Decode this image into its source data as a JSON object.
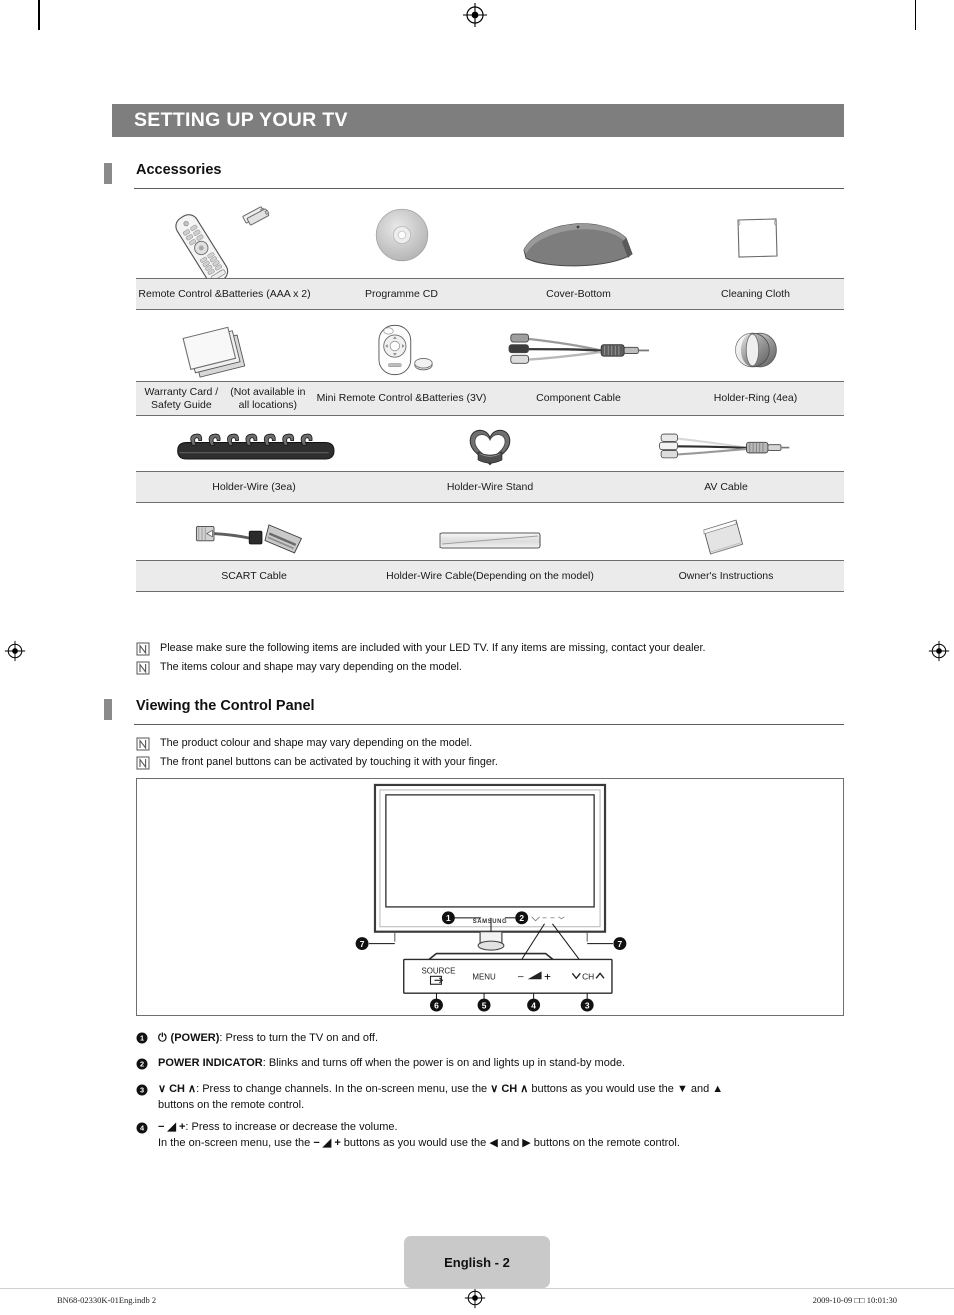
{
  "document": {
    "chapter_title": "SETTING UP YOUR TV",
    "page_label": "English - 2",
    "print_left": "BN68-02330K-01Eng.indb   2",
    "print_right": "2009-10-09   □□ 10:01:30"
  },
  "colors": {
    "banner_bg": "#7e7e7e",
    "banner_text": "#ffffff",
    "table_row_bg": "#ebebeb",
    "rule": "#6e6e6e",
    "footer_badge_bg": "#c9c9c9"
  },
  "sections": {
    "accessories": {
      "heading": "Accessories"
    },
    "control_panel": {
      "heading": "Viewing the Control Panel"
    }
  },
  "accessories": {
    "rows": [
      {
        "columns": 4,
        "items": [
          {
            "icon": "remote-control-with-batteries",
            "label": "Remote Control &\nBatteries (AAA x 2)"
          },
          {
            "icon": "programme-cd-disc",
            "label": "Programme CD"
          },
          {
            "icon": "cover-bottom-panel",
            "label": "Cover-Bottom"
          },
          {
            "icon": "cleaning-cloth",
            "label": "Cleaning Cloth"
          }
        ]
      },
      {
        "columns": 4,
        "items": [
          {
            "icon": "warranty-card-safety-guide",
            "label": "Warranty Card / Safety Guide\n(Not available in all locations)"
          },
          {
            "icon": "mini-remote-control-with-coin-battery",
            "label": "Mini Remote Control &\nBatteries (3V)"
          },
          {
            "icon": "component-cable",
            "label": "Component Cable"
          },
          {
            "icon": "holder-ring",
            "label": "Holder-Ring (4ea)"
          }
        ]
      },
      {
        "columns": 3,
        "items": [
          {
            "icon": "holder-wire-strip",
            "label": "Holder-Wire (3ea)"
          },
          {
            "icon": "holder-wire-stand",
            "label": "Holder-Wire Stand"
          },
          {
            "icon": "av-cable",
            "label": "AV Cable"
          }
        ]
      },
      {
        "columns": 3,
        "items": [
          {
            "icon": "scart-cable",
            "label": "SCART Cable"
          },
          {
            "icon": "holder-wire-cable",
            "label": "Holder-Wire Cable\n(Depending on the model)"
          },
          {
            "icon": "owners-instructions-booklet",
            "label": "Owner's Instructions"
          }
        ]
      }
    ]
  },
  "accessory_notes": [
    {
      "icon": "note-icon",
      "text": "Please make sure the following items are included with your LED TV. If any items are missing, contact your dealer."
    },
    {
      "icon": "note-icon",
      "text": "The items colour and shape may vary depending on the model."
    }
  ],
  "control_panel_notes": [
    {
      "icon": "note-icon",
      "text": "The product colour and shape may vary depending on the model."
    },
    {
      "icon": "note-icon",
      "text": "The front panel buttons can be activated by touching it with your finger."
    }
  ],
  "tv_diagram": {
    "brand_logo": "SAMSUNG",
    "callouts": [
      "1",
      "2",
      "3",
      "4",
      "5",
      "6",
      "7",
      "7"
    ],
    "panel_buttons": [
      {
        "id": "6",
        "label": "SOURCE",
        "icon": "source-input-icon"
      },
      {
        "id": "5",
        "label": "MENU",
        "icon": ""
      },
      {
        "id": "4",
        "label": "− ◢ +",
        "icon": "volume-icon"
      },
      {
        "id": "3",
        "label": "∨ CH ∧",
        "icon": "channel-icon"
      }
    ]
  },
  "panel_descriptions": [
    {
      "num": "1",
      "lines": [
        {
          "parts": [
            {
              "t": "⏻ ",
              "style": "glyph"
            },
            {
              "t": "(POWER)",
              "style": "bold"
            },
            {
              "t": ": Press to turn the TV on and off.",
              "style": "normal"
            }
          ]
        }
      ]
    },
    {
      "num": "2",
      "lines": [
        {
          "parts": [
            {
              "t": "POWER INDICATOR",
              "style": "bold"
            },
            {
              "t": ": Blinks and turns off when the power is on and lights up in stand-by mode.",
              "style": "normal"
            }
          ]
        }
      ]
    },
    {
      "num": "3",
      "lines": [
        {
          "parts": [
            {
              "t": "∨ CH ∧",
              "style": "bold"
            },
            {
              "t": ": Press to change channels. In the on-screen menu, use the ",
              "style": "normal"
            },
            {
              "t": "∨ CH ∧",
              "style": "bold"
            },
            {
              "t": " buttons as you would use the ▼ and ▲",
              "style": "normal"
            }
          ]
        },
        {
          "parts": [
            {
              "t": "buttons on the remote control.",
              "style": "normal"
            }
          ]
        }
      ]
    },
    {
      "num": "4",
      "lines": [
        {
          "parts": [
            {
              "t": "− ◢ +",
              "style": "bold"
            },
            {
              "t": ": Press to increase or decrease the volume.",
              "style": "normal"
            }
          ]
        },
        {
          "parts": [
            {
              "t": "In the on-screen menu, use the ",
              "style": "normal"
            },
            {
              "t": "− ◢ +",
              "style": "bold"
            },
            {
              "t": " buttons as you would use the ◀ and ▶ buttons on the remote control.",
              "style": "normal"
            }
          ]
        }
      ]
    }
  ]
}
